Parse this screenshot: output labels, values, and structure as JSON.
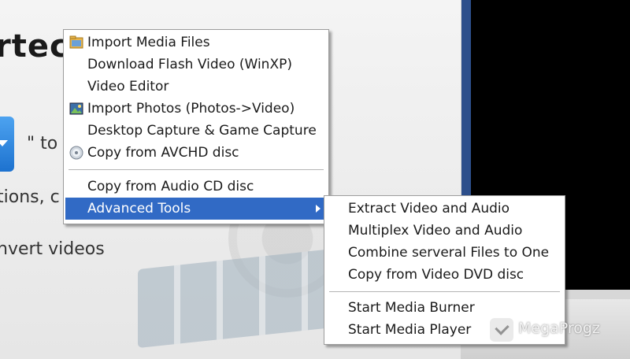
{
  "background": {
    "title_fragment": "rtec",
    "to_fragment": "\" to",
    "line2_fragment": "tions, c",
    "line3_fragment": "nvert videos"
  },
  "menu": {
    "items": [
      {
        "label": "Import Media Files",
        "icon": "folder-media-icon"
      },
      {
        "label": "Download Flash Video (WinXP)"
      },
      {
        "label": "Video Editor"
      },
      {
        "label": "Import Photos (Photos->Video)",
        "icon": "photo-icon"
      },
      {
        "label": "Desktop Capture & Game Capture"
      },
      {
        "label": "Copy from AVCHD disc",
        "icon": "disc-icon"
      },
      {
        "label": "Copy from Audio CD disc"
      },
      {
        "label": "Advanced Tools",
        "selected": true,
        "has_submenu": true
      }
    ]
  },
  "submenu": {
    "items": [
      {
        "label": "Extract Video and Audio"
      },
      {
        "label": "Multiplex Video and Audio"
      },
      {
        "label": "Combine serveral Files to One"
      },
      {
        "label": "Copy from Video DVD disc"
      },
      {
        "label": "Start Media Burner"
      },
      {
        "label": "Start Media Player"
      }
    ]
  },
  "watermark": {
    "text": "MegaProgz",
    "icon": "shield-check-icon"
  },
  "colors": {
    "selection": "#316ac5",
    "side_blue": "#2d4f8b"
  }
}
